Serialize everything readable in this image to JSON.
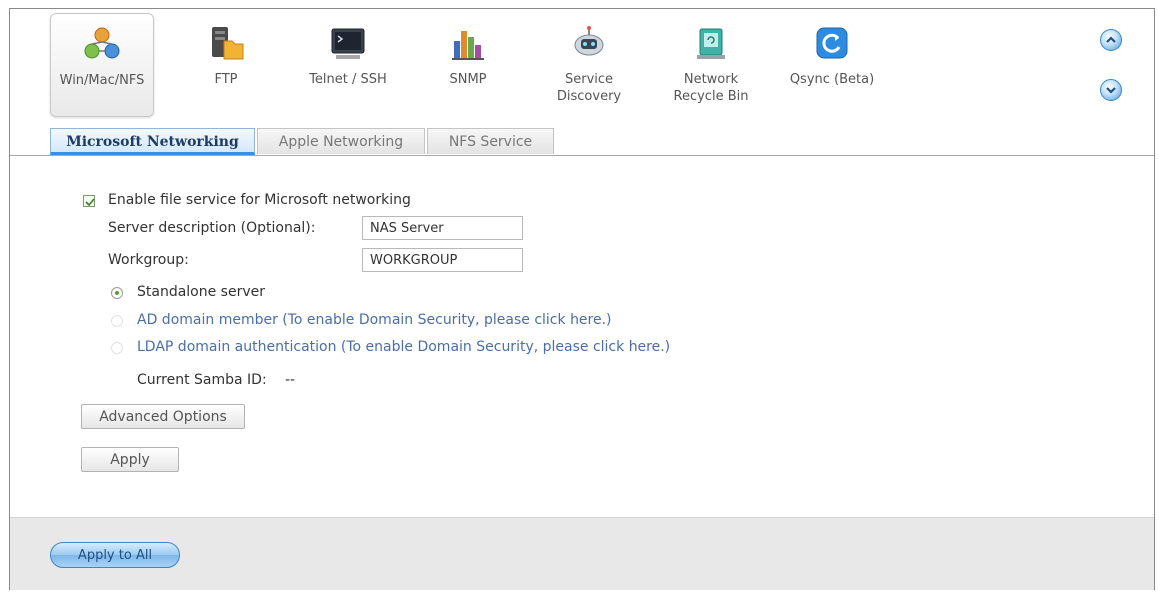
{
  "toolbar": {
    "services": [
      {
        "label": "Win/Mac/NFS"
      },
      {
        "label": "FTP"
      },
      {
        "label": "Telnet / SSH"
      },
      {
        "label": "SNMP"
      },
      {
        "label": "Service Discovery"
      },
      {
        "label": "Network Recycle Bin"
      },
      {
        "label": "Qsync (Beta)"
      }
    ],
    "active_service": "Win/Mac/NFS"
  },
  "tabs": [
    {
      "label": "Microsoft Networking",
      "active": true
    },
    {
      "label": "Apple Networking",
      "active": false
    },
    {
      "label": "NFS Service",
      "active": false
    }
  ],
  "form": {
    "enable_label": "Enable file service for Microsoft networking",
    "enable_checked": true,
    "server_desc_label": "Server description (Optional):",
    "server_desc_value": "NAS Server",
    "workgroup_label": "Workgroup:",
    "workgroup_value": "WORKGROUP",
    "radio_standalone": "Standalone server",
    "radio_ad": "AD domain member (To enable Domain Security, please click here.)",
    "radio_ldap": "LDAP domain authentication (To enable Domain Security, please click here.)",
    "selected_mode": "Standalone server",
    "samba_id_label": "Current Samba ID:",
    "samba_id_value": "--",
    "advanced_button": "Advanced Options",
    "apply_button": "Apply"
  },
  "footer": {
    "apply_all_button": "Apply to All"
  },
  "colors": {
    "tab_active_accent": "#3b8fde",
    "link": "#4a6ea8",
    "radio_selected": "#5c9a42",
    "footer_bg": "#e8e8e8"
  },
  "icons": {
    "win_mac_nfs": "win-mac-nfs-icon",
    "ftp": "ftp-icon",
    "telnet_ssh": "terminal-icon",
    "snmp": "snmp-chart-icon",
    "service_discovery": "service-discovery-icon",
    "network_recycle_bin": "recycle-bin-icon",
    "qsync": "qsync-icon",
    "scroll_up": "chevron-up-icon",
    "scroll_down": "chevron-down-icon"
  }
}
